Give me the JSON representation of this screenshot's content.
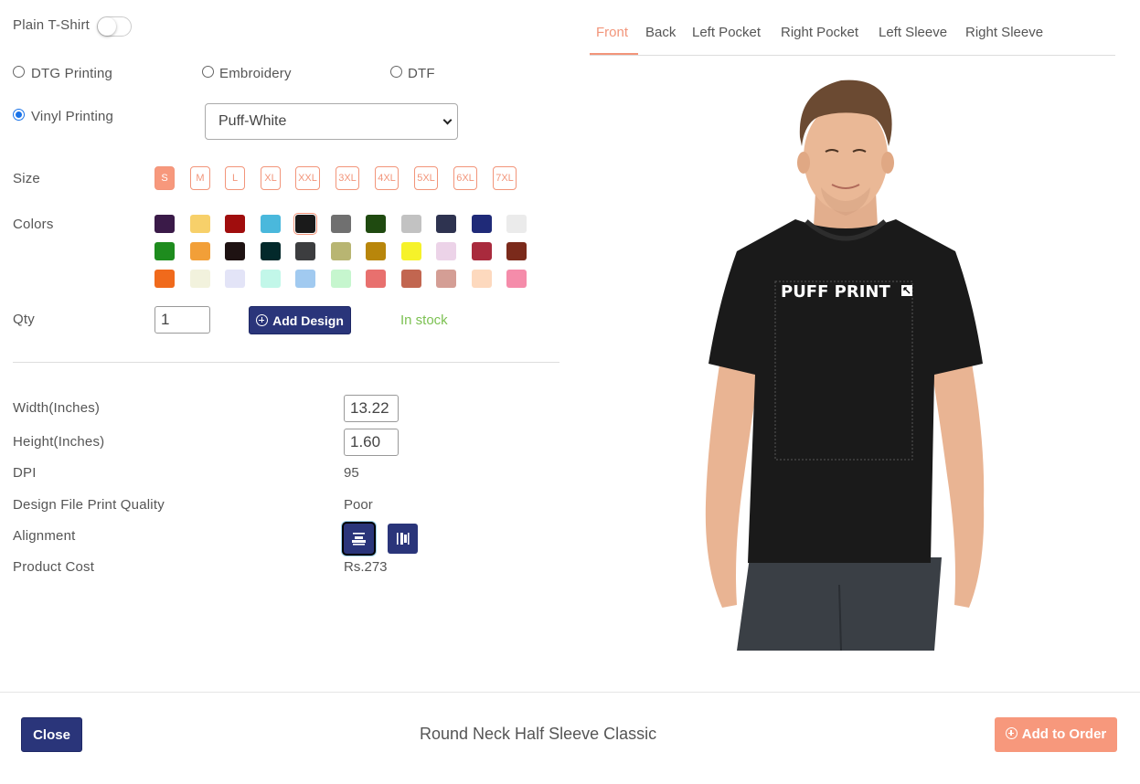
{
  "plain_tshirt": {
    "label": "Plain T-Shirt",
    "enabled": false
  },
  "print_methods": [
    {
      "label": "DTG Printing",
      "checked": false
    },
    {
      "label": "Embroidery",
      "checked": false
    },
    {
      "label": "DTF",
      "checked": false
    },
    {
      "label": "Vinyl Printing",
      "checked": true
    }
  ],
  "vinyl_select": {
    "value": "Puff-White"
  },
  "size": {
    "label": "Size",
    "options": [
      "S",
      "M",
      "L",
      "XL",
      "XXL",
      "3XL",
      "4XL",
      "5XL",
      "6XL",
      "7XL"
    ],
    "selected": "S"
  },
  "colors": {
    "label": "Colors",
    "selected_index": 4,
    "swatches": [
      "#3a1a48",
      "#f7d06a",
      "#a00d0d",
      "#4ab8dc",
      "#1a1a1a",
      "#707070",
      "#1f4a10",
      "#c2c2c2",
      "#2e3350",
      "#1f2a78",
      "#ebebeb",
      "#1e8c1e",
      "#f29f38",
      "#1e1212",
      "#03292b",
      "#3c3d3f",
      "#b8b572",
      "#b8860b",
      "#f6f22a",
      "#ecd3e8",
      "#a92a3d",
      "#7b2a1b",
      "#f06a1c",
      "#f2f2dd",
      "#e3e4f7",
      "#c2f7e9",
      "#a1caf0",
      "#c6f6ce",
      "#e8706e",
      "#c26650",
      "#d49e95",
      "#fdd9be",
      "#f58caa"
    ]
  },
  "qty": {
    "label": "Qty",
    "value": "1"
  },
  "add_design_label": "Add Design",
  "stock_status": "In stock",
  "specs": {
    "width_label": "Width(Inches)",
    "width_value": "13.22",
    "height_label": "Height(Inches)",
    "height_value": "1.60",
    "dpi_label": "DPI",
    "dpi_value": "95",
    "quality_label": "Design File Print Quality",
    "quality_value": "Poor",
    "alignment_label": "Alignment",
    "cost_label": "Product Cost",
    "cost_value": "Rs.273"
  },
  "tabs": [
    "Front",
    "Back",
    "Left Pocket",
    "Right Pocket",
    "Left Sleeve",
    "Right Sleeve"
  ],
  "active_tab": "Front",
  "preview": {
    "print_text": "PUFF PRINT",
    "shirt_color": "#1a1a1a"
  },
  "footer": {
    "close_label": "Close",
    "product_name": "Round Neck Half Sleeve Classic",
    "add_to_order_label": "Add to Order"
  }
}
